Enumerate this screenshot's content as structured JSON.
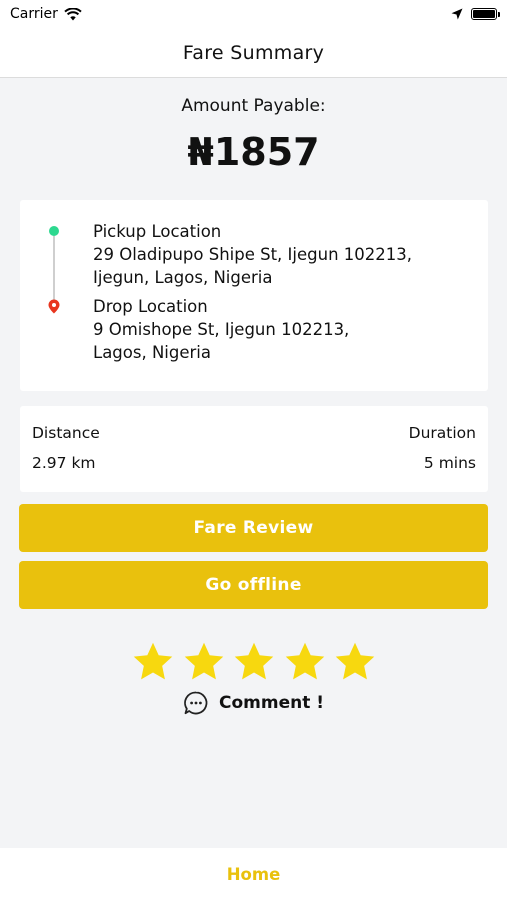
{
  "status_bar": {
    "carrier": "Carrier",
    "wifi_icon": "wifi-icon",
    "location_icon": "location-arrow-icon",
    "battery_icon": "battery-icon"
  },
  "header": {
    "title": "Fare Summary"
  },
  "fare": {
    "amount_label": "Amount Payable:",
    "amount_value": "₦1857"
  },
  "locations": {
    "pickup_title": "Pickup Location",
    "pickup_address_line1": "29 Oladipupo Shipe St, Ijegun 102213,",
    "pickup_address_line2": "Ijegun, Lagos, Nigeria",
    "drop_title": "Drop Location",
    "drop_address_line1": "9 Omishope St, Ijegun 102213,",
    "drop_address_line2": "Lagos, Nigeria",
    "pickup_color": "#2dd88f",
    "drop_color": "#e8351f"
  },
  "trip": {
    "distance_label": "Distance",
    "distance_value": "2.97 km",
    "duration_label": "Duration",
    "duration_value": "5 mins"
  },
  "actions": {
    "fare_review_label": "Fare Review",
    "go_offline_label": "Go offline"
  },
  "rating": {
    "stars": 5,
    "max_stars": 5,
    "star_color": "#f7d80f",
    "comment_label": "Comment !",
    "comment_icon": "chat-bubble-icon"
  },
  "tab_bar": {
    "home_label": "Home"
  },
  "colors": {
    "accent": "#e9c10d",
    "background": "#f3f4f6"
  }
}
